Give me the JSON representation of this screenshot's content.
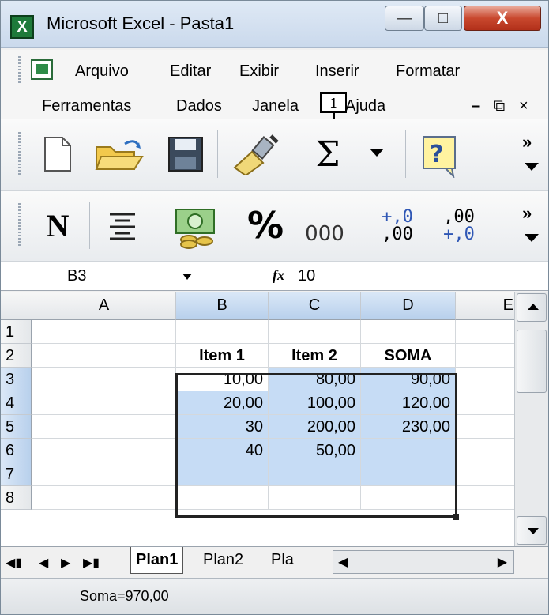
{
  "window": {
    "title": "Microsoft Excel - Pasta1"
  },
  "menu": {
    "row1": [
      "Arquivo",
      "Editar",
      "Exibir",
      "Inserir",
      "Formatar"
    ],
    "row2": [
      "Ferramentas",
      "Dados",
      "Janela",
      "Ajuda"
    ],
    "callout": "1"
  },
  "formula_bar": {
    "name_box": "B3",
    "fx": "fx",
    "value": "10"
  },
  "grid": {
    "columns": [
      "A",
      "B",
      "C",
      "D",
      "E"
    ],
    "rows": [
      "1",
      "2",
      "3",
      "4",
      "5",
      "6",
      "7",
      "8"
    ],
    "cells": {
      "B2": "Item 1",
      "C2": "Item 2",
      "D2": "SOMA",
      "B3": "10,00",
      "C3": "80,00",
      "D3": "90,00",
      "B4": "20,00",
      "C4": "100,00",
      "D4": "120,00",
      "B5": "30",
      "C5": "200,00",
      "D5": "230,00",
      "B6": "40",
      "C6": "50,00"
    }
  },
  "sheets": [
    "Plan1",
    "Plan2",
    "Pla"
  ],
  "status": {
    "text": "Soma=970,00"
  },
  "toolbar2": {
    "bold": "N",
    "percent": "%",
    "thousands": "000",
    "inc_dec": [
      "+,0",
      ",00"
    ],
    "dec_dec": [
      ",00",
      "+,0"
    ]
  }
}
